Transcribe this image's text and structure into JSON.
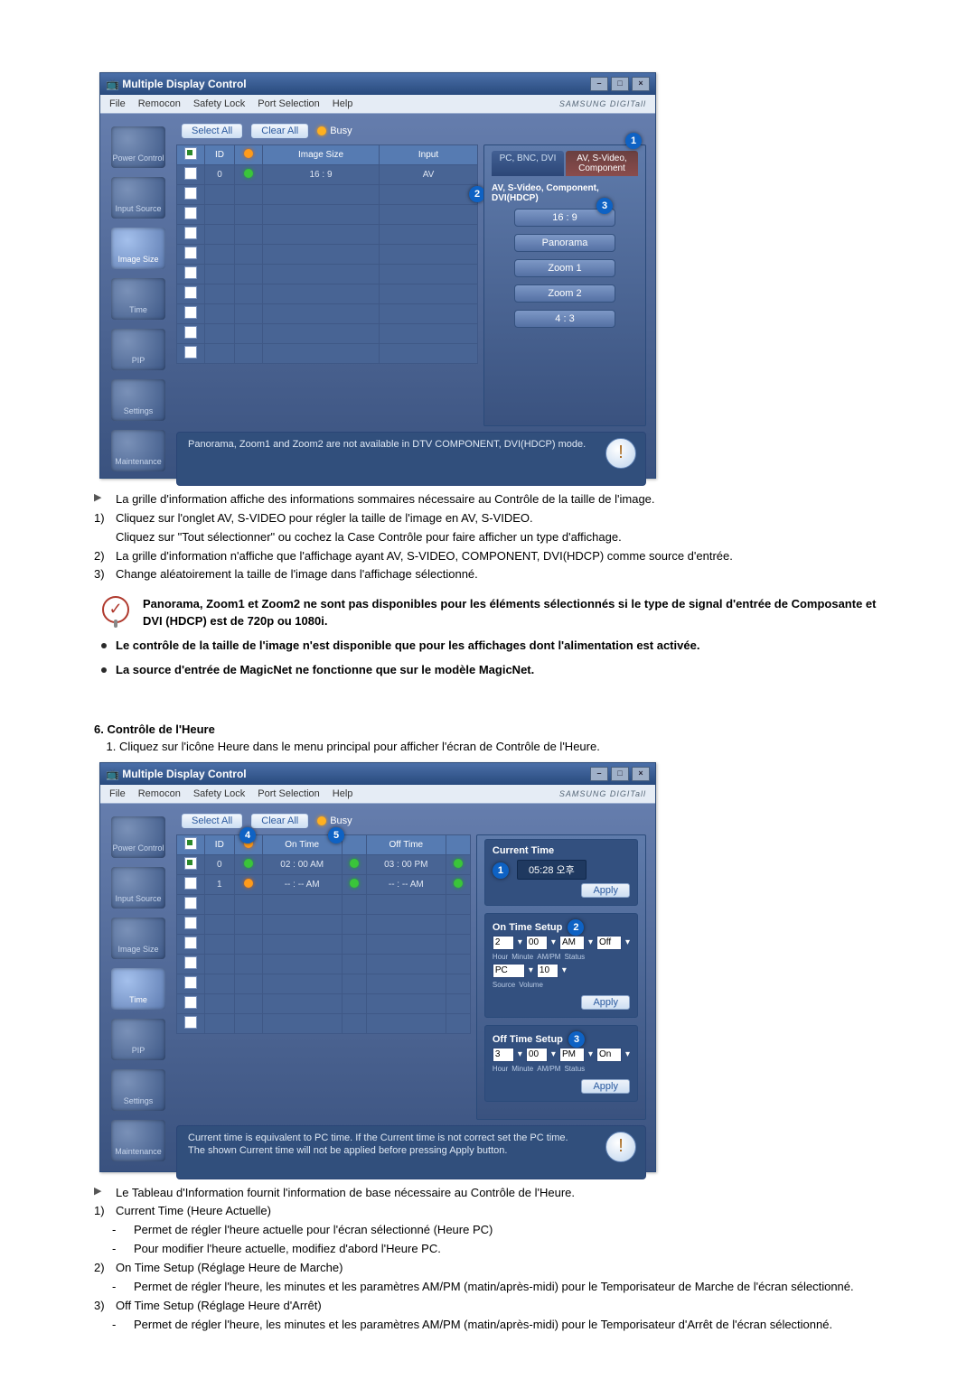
{
  "app": {
    "title": "Multiple Display Control",
    "menu": [
      "File",
      "Remocon",
      "Safety Lock",
      "Port Selection",
      "Help"
    ],
    "logo": "SAMSUNG DIGITall",
    "sidebar": [
      "Power Control",
      "Input Source",
      "Image Size",
      "Time",
      "PIP",
      "Settings",
      "Maintenance"
    ],
    "buttons": {
      "selectAll": "Select All",
      "clearAll": "Clear All"
    },
    "busy": "Busy"
  },
  "image_size": {
    "columns": [
      "",
      "ID",
      "",
      "Image Size",
      "Input"
    ],
    "first_row": {
      "id": "0",
      "size": "16 : 9",
      "input": "AV"
    },
    "tabs": [
      "PC, BNC, DVI",
      "AV, S-Video, Component"
    ],
    "sub_header": "AV, S-Video, Component, DVI(HDCP)",
    "ratios": [
      "16 : 9",
      "Panorama",
      "Zoom 1",
      "Zoom 2",
      "4 : 3"
    ],
    "footer_note": "Panorama, Zoom1 and Zoom2 are not available in DTV COMPONENT, DVI(HDCP) mode.",
    "badges": {
      "one": "1",
      "two": "2",
      "three": "3"
    }
  },
  "text_image_size": {
    "intro": "La grille d'information affiche des informations sommaires nécessaire au Contrôle de la taille de l'image.",
    "p1a": "Cliquez sur l'onglet AV, S-VIDEO pour régler la taille de l'image en AV, S-VIDEO.",
    "p1b": "Cliquez sur \"Tout sélectionner\" ou cochez la Case Contrôle pour faire afficher un type d'affichage.",
    "p2": "La grille d'information n'affiche que l'affichage ayant AV, S-VIDEO, COMPONENT, DVI(HDCP) comme source d'entrée.",
    "p3": "Change aléatoirement la taille de l'image dans l'affichage sélectionné.",
    "note": "Panorama, Zoom1 et Zoom2 ne sont pas disponibles pour les éléments sélectionnés si le type de signal d'entrée de Composante et DVI (HDCP) est de 720p ou 1080i.",
    "bullet1": "Le contrôle de la taille de l'image n'est disponible que pour les affichages dont l'alimentation est activée.",
    "bullet2": "La source d'entrée de MagicNet ne fonctionne que sur le modèle MagicNet."
  },
  "section_time": {
    "heading": "6. Contrôle de l'Heure",
    "step1": "Cliquez sur l'icône Heure dans le menu principal pour afficher l'écran de Contrôle de l'Heure."
  },
  "time": {
    "columns": {
      "on": "On Time",
      "off": "Off Time"
    },
    "row0": {
      "id": "0",
      "on": "02 : 00  AM",
      "off": "03 : 00  PM"
    },
    "row1": {
      "id": "1",
      "on": "-- : --  AM",
      "off": "-- : --  AM"
    },
    "panel": {
      "currentTitle": "Current Time",
      "currentValue": "05:28 오후",
      "onTitle": "On Time Setup",
      "offTitle": "Off Time Setup",
      "apply": "Apply",
      "on": {
        "hour": "2",
        "min": "00",
        "ampm": "AM",
        "status": "Off",
        "source": "PC",
        "volume": "10"
      },
      "off": {
        "hour": "3",
        "min": "00",
        "ampm": "PM",
        "status": "On"
      },
      "labels": {
        "hour": "Hour",
        "minute": "Minute",
        "ampm": "AM/PM",
        "status": "Status",
        "source": "Source",
        "volume": "Volume"
      }
    },
    "badges": {
      "one": "1",
      "two": "2",
      "three": "3",
      "four": "4",
      "five": "5"
    },
    "footer_a": "Current time is equivalent to PC time. If the Current time is not correct set the PC time.",
    "footer_b": "The shown Current time will not be applied before pressing Apply button."
  },
  "text_time": {
    "intro": "Le Tableau d'Information fournit l'information de base nécessaire au Contrôle de l'Heure.",
    "i1": "Current Time (Heure Actuelle)",
    "i1a": "Permet de régler l'heure actuelle pour l'écran sélectionné (Heure PC)",
    "i1b": "Pour modifier l'heure actuelle, modifiez d'abord l'Heure PC.",
    "i2": "On Time Setup (Réglage Heure de Marche)",
    "i2a": "Permet de régler l'heure, les minutes et les paramètres AM/PM (matin/après-midi) pour le Temporisateur de Marche de l'écran sélectionné.",
    "i3": "Off Time Setup (Réglage Heure d'Arrêt)",
    "i3a": "Permet de régler l'heure, les minutes et les paramètres AM/PM (matin/après-midi) pour le Temporisateur d'Arrêt de l'écran sélectionné."
  }
}
